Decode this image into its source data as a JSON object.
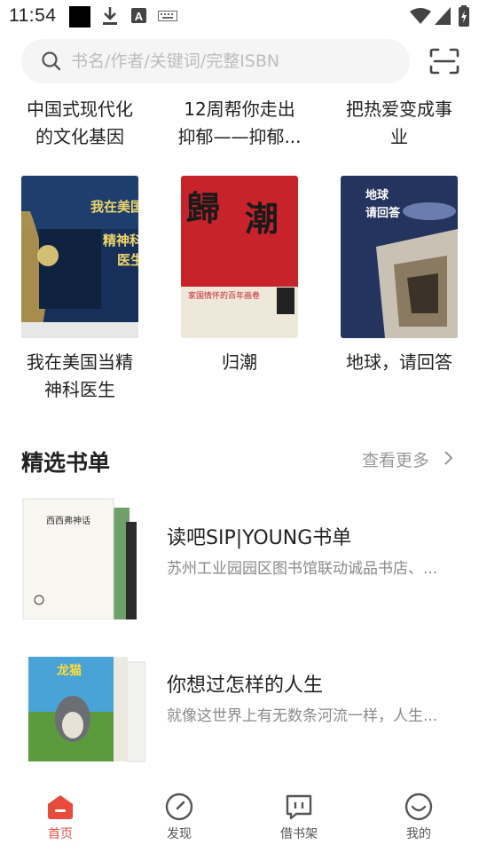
{
  "status_bar": {
    "time": "11:54"
  },
  "search": {
    "placeholder": "书名/作者/关键词/完整ISBN"
  },
  "books_top_row": [
    {
      "title_line1": "中国式现代化",
      "title_line2": "的文化基因"
    },
    {
      "title_line1": "12周帮你走出",
      "title_line2": "抑郁——抑郁..."
    },
    {
      "title_line1": "把热爱变成事",
      "title_line2": "业"
    }
  ],
  "books_second_row": [
    {
      "title_line1": "我在美国当精",
      "title_line2": "神科医生",
      "cover_text": "我在美国当精神科医生",
      "cover_color": "#1e3f6e"
    },
    {
      "title_line1": "归潮",
      "title_line2": "",
      "cover_text": "归潮",
      "cover_color": "#c8232a"
    },
    {
      "title_line1": "地球，请回答",
      "title_line2": "",
      "cover_text": "地球 请回答",
      "cover_color": "#2a3a66"
    }
  ],
  "section": {
    "title": "精选书单",
    "see_more": "查看更多"
  },
  "booklists": [
    {
      "title": "读吧SIP|YOUNG书单",
      "description": "苏州工业园园区图书馆联动诚品书店、...",
      "cover_text": "西西弗神话"
    },
    {
      "title": "你想过怎样的人生",
      "description": "就像这世界上有无数条河流一样，人生...",
      "cover_text": "龙猫"
    }
  ],
  "bottom_nav": [
    {
      "label": "首页",
      "icon": "home-icon",
      "active": true
    },
    {
      "label": "发现",
      "icon": "compass-icon",
      "active": false
    },
    {
      "label": "借书架",
      "icon": "bookshelf-icon",
      "active": false
    },
    {
      "label": "我的",
      "icon": "smile-icon",
      "active": false
    }
  ],
  "colors": {
    "accent": "#e84b3c",
    "muted": "#999999",
    "search_bg": "#f5f5f5"
  }
}
